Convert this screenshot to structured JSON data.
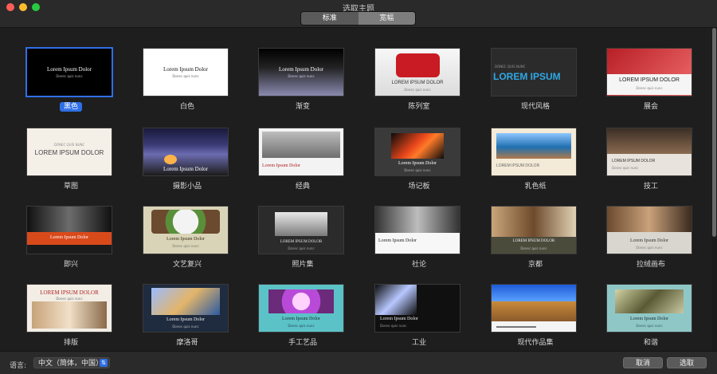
{
  "window": {
    "title": "选取主题"
  },
  "segmented": {
    "left": "标准",
    "right": "宽幅"
  },
  "themes": [
    {
      "label": "黑色",
      "thumb_title": "Lorem Ipsum Dolor",
      "thumb_sub": "Donec quis nunc",
      "selected": true
    },
    {
      "label": "白色",
      "thumb_title": "Lorem Ipsum Dolor",
      "thumb_sub": "Donec quis nunc"
    },
    {
      "label": "渐变",
      "thumb_title": "Lorem Ipsum Dolor",
      "thumb_sub": "Donec quis nunc"
    },
    {
      "label": "陈列室",
      "thumb_title": "LOREM IPSUM DOLOR",
      "thumb_sub": "Donec quis nunc"
    },
    {
      "label": "现代风格",
      "thumb_title": "LOREM IPSUM",
      "thumb_sub": "DONEC QUIS NUNC"
    },
    {
      "label": "展会",
      "thumb_title": "LOREM IPSUM DOLOR",
      "thumb_sub": "Donec quis nunc"
    },
    {
      "label": "草图",
      "thumb_title": "LOREM IPSUM DOLOR",
      "thumb_sub": "DONEC QUIS NUNC"
    },
    {
      "label": "摄影小品",
      "thumb_title": "Lorem Ipsum Dolor",
      "thumb_sub": "Donec quis nunc"
    },
    {
      "label": "经典",
      "thumb_title": "Lorem Ipsum Dolor",
      "thumb_sub": "Donec quis nunc"
    },
    {
      "label": "场记板",
      "thumb_title": "Lorem Ipsum Dolor",
      "thumb_sub": "Donec quis nunc"
    },
    {
      "label": "乳色纸",
      "thumb_title": "LOREM IPSUM DOLOR",
      "thumb_sub": "Donec quis nunc"
    },
    {
      "label": "技工",
      "thumb_title": "LOREM IPSUM DOLOR",
      "thumb_sub": "Donec quis nunc"
    },
    {
      "label": "即兴",
      "thumb_title": "Lorem Ipsum Dolor",
      "thumb_sub": "Donec quis nunc"
    },
    {
      "label": "文艺复兴",
      "thumb_title": "Lorem Ipsum Dolor",
      "thumb_sub": "Donec quis nunc"
    },
    {
      "label": "照片集",
      "thumb_title": "LOREM IPSUM DOLOR",
      "thumb_sub": "Donec quis nunc"
    },
    {
      "label": "社论",
      "thumb_title": "Lorem Ipsum Dolor",
      "thumb_sub": "Donec quis nunc"
    },
    {
      "label": "京都",
      "thumb_title": "LOREM IPSUM DOLOR",
      "thumb_sub": "Donec quis nunc"
    },
    {
      "label": "拉绒画布",
      "thumb_title": "Lorem Ipsum Dolor",
      "thumb_sub": "Donec quis nunc"
    },
    {
      "label": "排版",
      "thumb_title": "LOREM IPSUM DOLOR",
      "thumb_sub": "Donec quis nunc"
    },
    {
      "label": "摩洛哥",
      "thumb_title": "Lorem Ipsum Dolor",
      "thumb_sub": "Donec quis nunc"
    },
    {
      "label": "手工艺品",
      "thumb_title": "Lorem Ipsum Dolor",
      "thumb_sub": "Donec quis nunc"
    },
    {
      "label": "工业",
      "thumb_title": "Lorem Ipsum Dolor",
      "thumb_sub": "Donec quis nunc"
    },
    {
      "label": "现代作品集",
      "thumb_title": "",
      "thumb_sub": ""
    },
    {
      "label": "和谐",
      "thumb_title": "Lorem Ipsum Dolor",
      "thumb_sub": "Donec quis nunc"
    }
  ],
  "footer": {
    "language_label": "语言:",
    "language_value": "中文（简体，中国）",
    "cancel": "取消",
    "choose": "选取"
  }
}
